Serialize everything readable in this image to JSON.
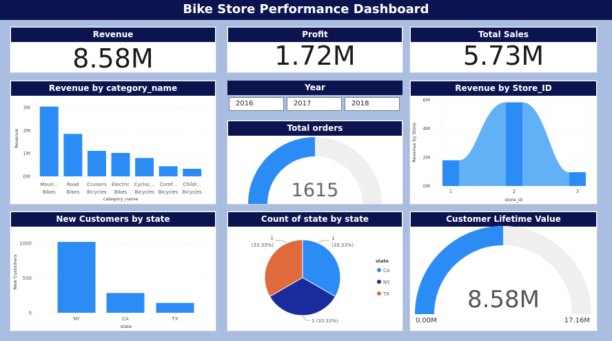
{
  "title": "Bike Store Performance Dashboard",
  "kpis": {
    "revenue": {
      "label": "Revenue",
      "value": "8.58M"
    },
    "profit": {
      "label": "Profit",
      "value": "1.72M"
    },
    "total_sales": {
      "label": "Total Sales",
      "value": "5.73M"
    }
  },
  "year_filter": {
    "label": "Year",
    "options": [
      "2016",
      "2017",
      "2018"
    ]
  },
  "total_orders": {
    "label": "Total orders",
    "value": "1615"
  },
  "clv": {
    "label": "Customer Lifetime Value",
    "value": "8.58M",
    "min": "0.00M",
    "max": "17.16M"
  },
  "colors": {
    "header": "#0c1450",
    "bar": "#2b8cf5",
    "pie_ca": "#2b8cf5",
    "pie_ny": "#1a2b9b",
    "pie_tx": "#e06a3b",
    "gauge_bg": "#efefef"
  },
  "chart_data": [
    {
      "type": "bar",
      "title": "Revenue by category_name",
      "xlabel": "category_name",
      "ylabel": "Revenue",
      "categories": [
        "Mountain Bikes",
        "Road Bikes",
        "Cruisers Bicycles",
        "Electric Bikes",
        "Cyclocross Bicycles",
        "Comfort Bicycles",
        "Children Bicycles"
      ],
      "tick_labels": [
        [
          "Moun...",
          "Bikes"
        ],
        [
          "Road",
          "Bikes"
        ],
        [
          "Cruisers",
          "Bicycles"
        ],
        [
          "Electric",
          "Bikes"
        ],
        [
          "Cycloc...",
          "Bicycles"
        ],
        [
          "Comf...",
          "Bicycles"
        ],
        [
          "Childr...",
          "Bicycles"
        ]
      ],
      "values": [
        3.04,
        1.85,
        1.11,
        1.02,
        0.8,
        0.44,
        0.33
      ],
      "ylim": [
        0,
        3.3
      ],
      "yticks": [
        {
          "v": 0,
          "label": "0M"
        },
        {
          "v": 1,
          "label": "1M"
        },
        {
          "v": 2,
          "label": "2M"
        },
        {
          "v": 3,
          "label": "3M"
        }
      ]
    },
    {
      "type": "area",
      "title": "Revenue by Store_ID",
      "xlabel": "store_id",
      "ylabel": "Revenue by Store",
      "x": [
        1,
        2,
        3
      ],
      "values": [
        1.79,
        5.83,
        0.96
      ],
      "ylim": [
        0,
        6
      ],
      "yticks": [
        {
          "v": 0,
          "label": "0M"
        },
        {
          "v": 2,
          "label": "2M"
        },
        {
          "v": 4,
          "label": "4M"
        },
        {
          "v": 6,
          "label": "6M"
        }
      ]
    },
    {
      "type": "bar",
      "title": "New Customers by state",
      "xlabel": "state",
      "ylabel": "New Customers",
      "categories": [
        "NY",
        "CA",
        "TX"
      ],
      "values": [
        1019,
        284,
        142
      ],
      "ylim": [
        0,
        1100
      ],
      "yticks": [
        {
          "v": 0,
          "label": "0"
        },
        {
          "v": 500,
          "label": "500"
        },
        {
          "v": 1000,
          "label": "1000"
        }
      ]
    },
    {
      "type": "pie",
      "title": "Count of state by state",
      "legend_title": "state",
      "categories": [
        "CA",
        "NY",
        "TX"
      ],
      "values": [
        1,
        1,
        1
      ],
      "data_labels": [
        "1 (33.33%)",
        "1 (33.33%)",
        "1 (33.33%)"
      ]
    },
    {
      "type": "gauge",
      "title": "Total orders",
      "value": 1615,
      "fill_fraction": 0.5
    },
    {
      "type": "gauge",
      "title": "Customer Lifetime Value",
      "value": 8.58,
      "min": 0,
      "max": 17.16
    }
  ]
}
